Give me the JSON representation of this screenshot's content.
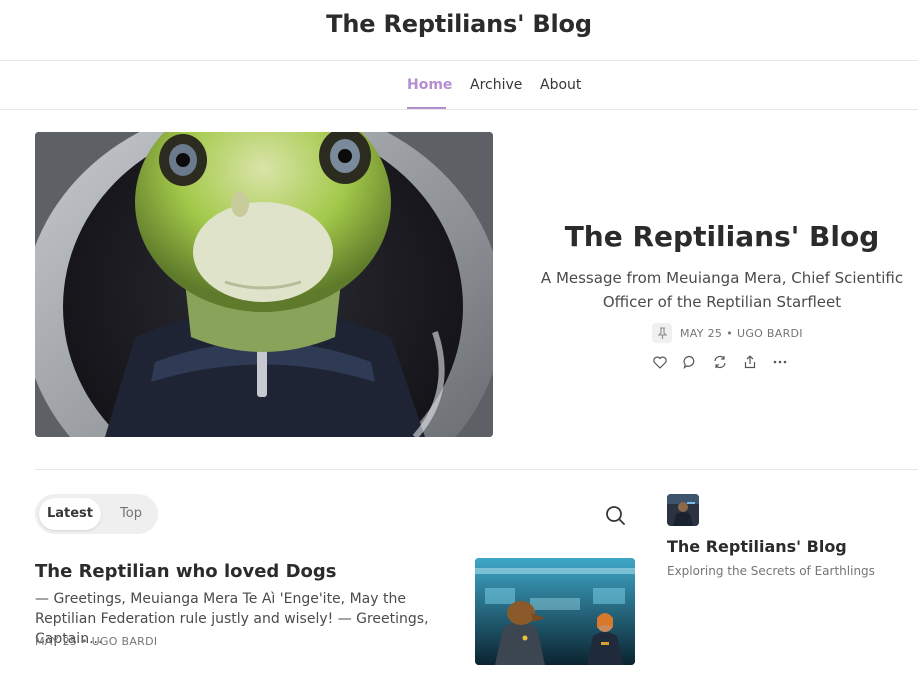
{
  "site": {
    "title": "The Reptilians' Blog"
  },
  "nav": {
    "items": [
      {
        "label": "Home"
      },
      {
        "label": "Archive"
      },
      {
        "label": "About"
      }
    ]
  },
  "hero": {
    "title": "The Reptilians' Blog",
    "subtitle": "A Message from Meuianga Mera, Chief Scientific Officer of the Reptilian Starfleet",
    "date": "MAY 25",
    "author": "UGO BARDI",
    "separator": "•",
    "icons": [
      "pin-icon",
      "heart-icon",
      "comment-icon",
      "restack-icon",
      "share-icon",
      "more-icon"
    ]
  },
  "feed": {
    "tabs": [
      {
        "label": "Latest"
      },
      {
        "label": "Top"
      }
    ],
    "posts": [
      {
        "title": "The Reptilian who loved Dogs",
        "excerpt": "— Greetings, Meuianga Mera Te Aì 'Enge'ite, May the Reptilian Federation rule justly and wisely! — Greetings, Captain...",
        "date": "MAY 25",
        "author": "UGO BARDI"
      }
    ]
  },
  "sidebar": {
    "title": "The Reptilians' Blog",
    "description": "Exploring the Secrets of Earthlings"
  },
  "colors": {
    "accent": "#b48ecf",
    "text": "#363737",
    "muted": "#757575",
    "border": "#e6e6e6"
  }
}
